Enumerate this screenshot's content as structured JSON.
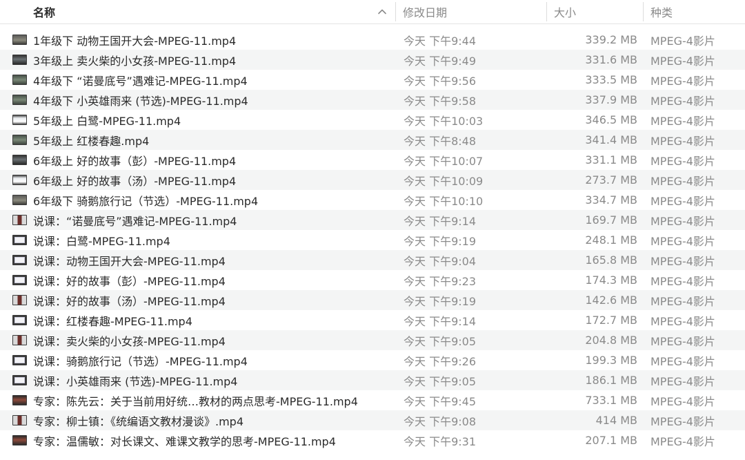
{
  "columns": {
    "name": "名称",
    "date": "修改日期",
    "size": "大小",
    "kind": "种类"
  },
  "sort": {
    "column": "name",
    "direction": "ascending",
    "icon": "chevron-up-icon"
  },
  "files": [
    {
      "thumb": "t-dark",
      "name": "1年级下 动物王国开大会-MPEG-11.mp4",
      "date": "今天 下午9:44",
      "size": "339.2 MB",
      "kind": "MPEG-4影片"
    },
    {
      "thumb": "t-room",
      "name": "3年级上 卖火柴的小女孩-MPEG-11.mp4",
      "date": "今天 下午9:49",
      "size": "331.6 MB",
      "kind": "MPEG-4影片"
    },
    {
      "thumb": "t-green",
      "name": "4年级下 “诺曼底号”遇难记-MPEG-11.mp4",
      "date": "今天 下午9:56",
      "size": "333.5 MB",
      "kind": "MPEG-4影片"
    },
    {
      "thumb": "t-green",
      "name": "4年级下 小英雄雨来 (节选)-MPEG-11.mp4",
      "date": "今天 下午9:58",
      "size": "337.9 MB",
      "kind": "MPEG-4影片"
    },
    {
      "thumb": "t-light",
      "name": "5年级上 白鹭-MPEG-11.mp4",
      "date": "今天 下午10:03",
      "size": "346.5 MB",
      "kind": "MPEG-4影片"
    },
    {
      "thumb": "t-green",
      "name": "5年级上 红楼春趣.mp4",
      "date": "今天 下午8:48",
      "size": "341.4 MB",
      "kind": "MPEG-4影片"
    },
    {
      "thumb": "t-room",
      "name": "6年级上 好的故事（彭）-MPEG-11.mp4",
      "date": "今天 下午10:07",
      "size": "331.1 MB",
      "kind": "MPEG-4影片"
    },
    {
      "thumb": "t-light",
      "name": "6年级上 好的故事（汤）-MPEG-11.mp4",
      "date": "今天 下午10:09",
      "size": "273.7 MB",
      "kind": "MPEG-4影片"
    },
    {
      "thumb": "t-dark",
      "name": "6年级下 骑鹅旅行记（节选）-MPEG-11.mp4",
      "date": "今天 下午10:10",
      "size": "334.7 MB",
      "kind": "MPEG-4影片"
    },
    {
      "thumb": "t-person",
      "name": "说课：“诺曼底号”遇难记-MPEG-11.mp4",
      "date": "今天 下午9:14",
      "size": "169.7 MB",
      "kind": "MPEG-4影片"
    },
    {
      "thumb": "t-slide",
      "name": "说课：白鹭-MPEG-11.mp4",
      "date": "今天 下午9:19",
      "size": "248.1 MB",
      "kind": "MPEG-4影片"
    },
    {
      "thumb": "t-slide",
      "name": "说课：动物王国开大会-MPEG-11.mp4",
      "date": "今天 下午9:04",
      "size": "165.8 MB",
      "kind": "MPEG-4影片"
    },
    {
      "thumb": "t-slide",
      "name": "说课：好的故事（彭）-MPEG-11.mp4",
      "date": "今天 下午9:23",
      "size": "174.3 MB",
      "kind": "MPEG-4影片"
    },
    {
      "thumb": "t-person",
      "name": "说课：好的故事（汤）-MPEG-11.mp4",
      "date": "今天 下午9:19",
      "size": "142.6 MB",
      "kind": "MPEG-4影片"
    },
    {
      "thumb": "t-slide",
      "name": "说课：红楼春趣-MPEG-11.mp4",
      "date": "今天 下午9:14",
      "size": "172.7 MB",
      "kind": "MPEG-4影片"
    },
    {
      "thumb": "t-person",
      "name": "说课：卖火柴的小女孩-MPEG-11.mp4",
      "date": "今天 下午9:05",
      "size": "204.8 MB",
      "kind": "MPEG-4影片"
    },
    {
      "thumb": "t-slide",
      "name": "说课：骑鹅旅行记（节选）-MPEG-11.mp4",
      "date": "今天 下午9:26",
      "size": "199.3 MB",
      "kind": "MPEG-4影片"
    },
    {
      "thumb": "t-slide",
      "name": "说课：小英雄雨来 (节选)-MPEG-11.mp4",
      "date": "今天 下午9:05",
      "size": "186.1 MB",
      "kind": "MPEG-4影片"
    },
    {
      "thumb": "t-expert",
      "name": "专家：陈先云：关于当前用好统…教材的两点思考-MPEG-11.mp4",
      "date": "今天 下午9:45",
      "size": "733.1 MB",
      "kind": "MPEG-4影片"
    },
    {
      "thumb": "t-person",
      "name": "专家：柳士镇：《统编语文教材漫谈》.mp4",
      "date": "今天 下午9:08",
      "size": "414 MB",
      "kind": "MPEG-4影片"
    },
    {
      "thumb": "t-expert",
      "name": "专家：温儒敏：对长课文、难课文教学的思考-MPEG-11.mp4",
      "date": "今天 下午9:31",
      "size": "207.1 MB",
      "kind": "MPEG-4影片"
    }
  ]
}
